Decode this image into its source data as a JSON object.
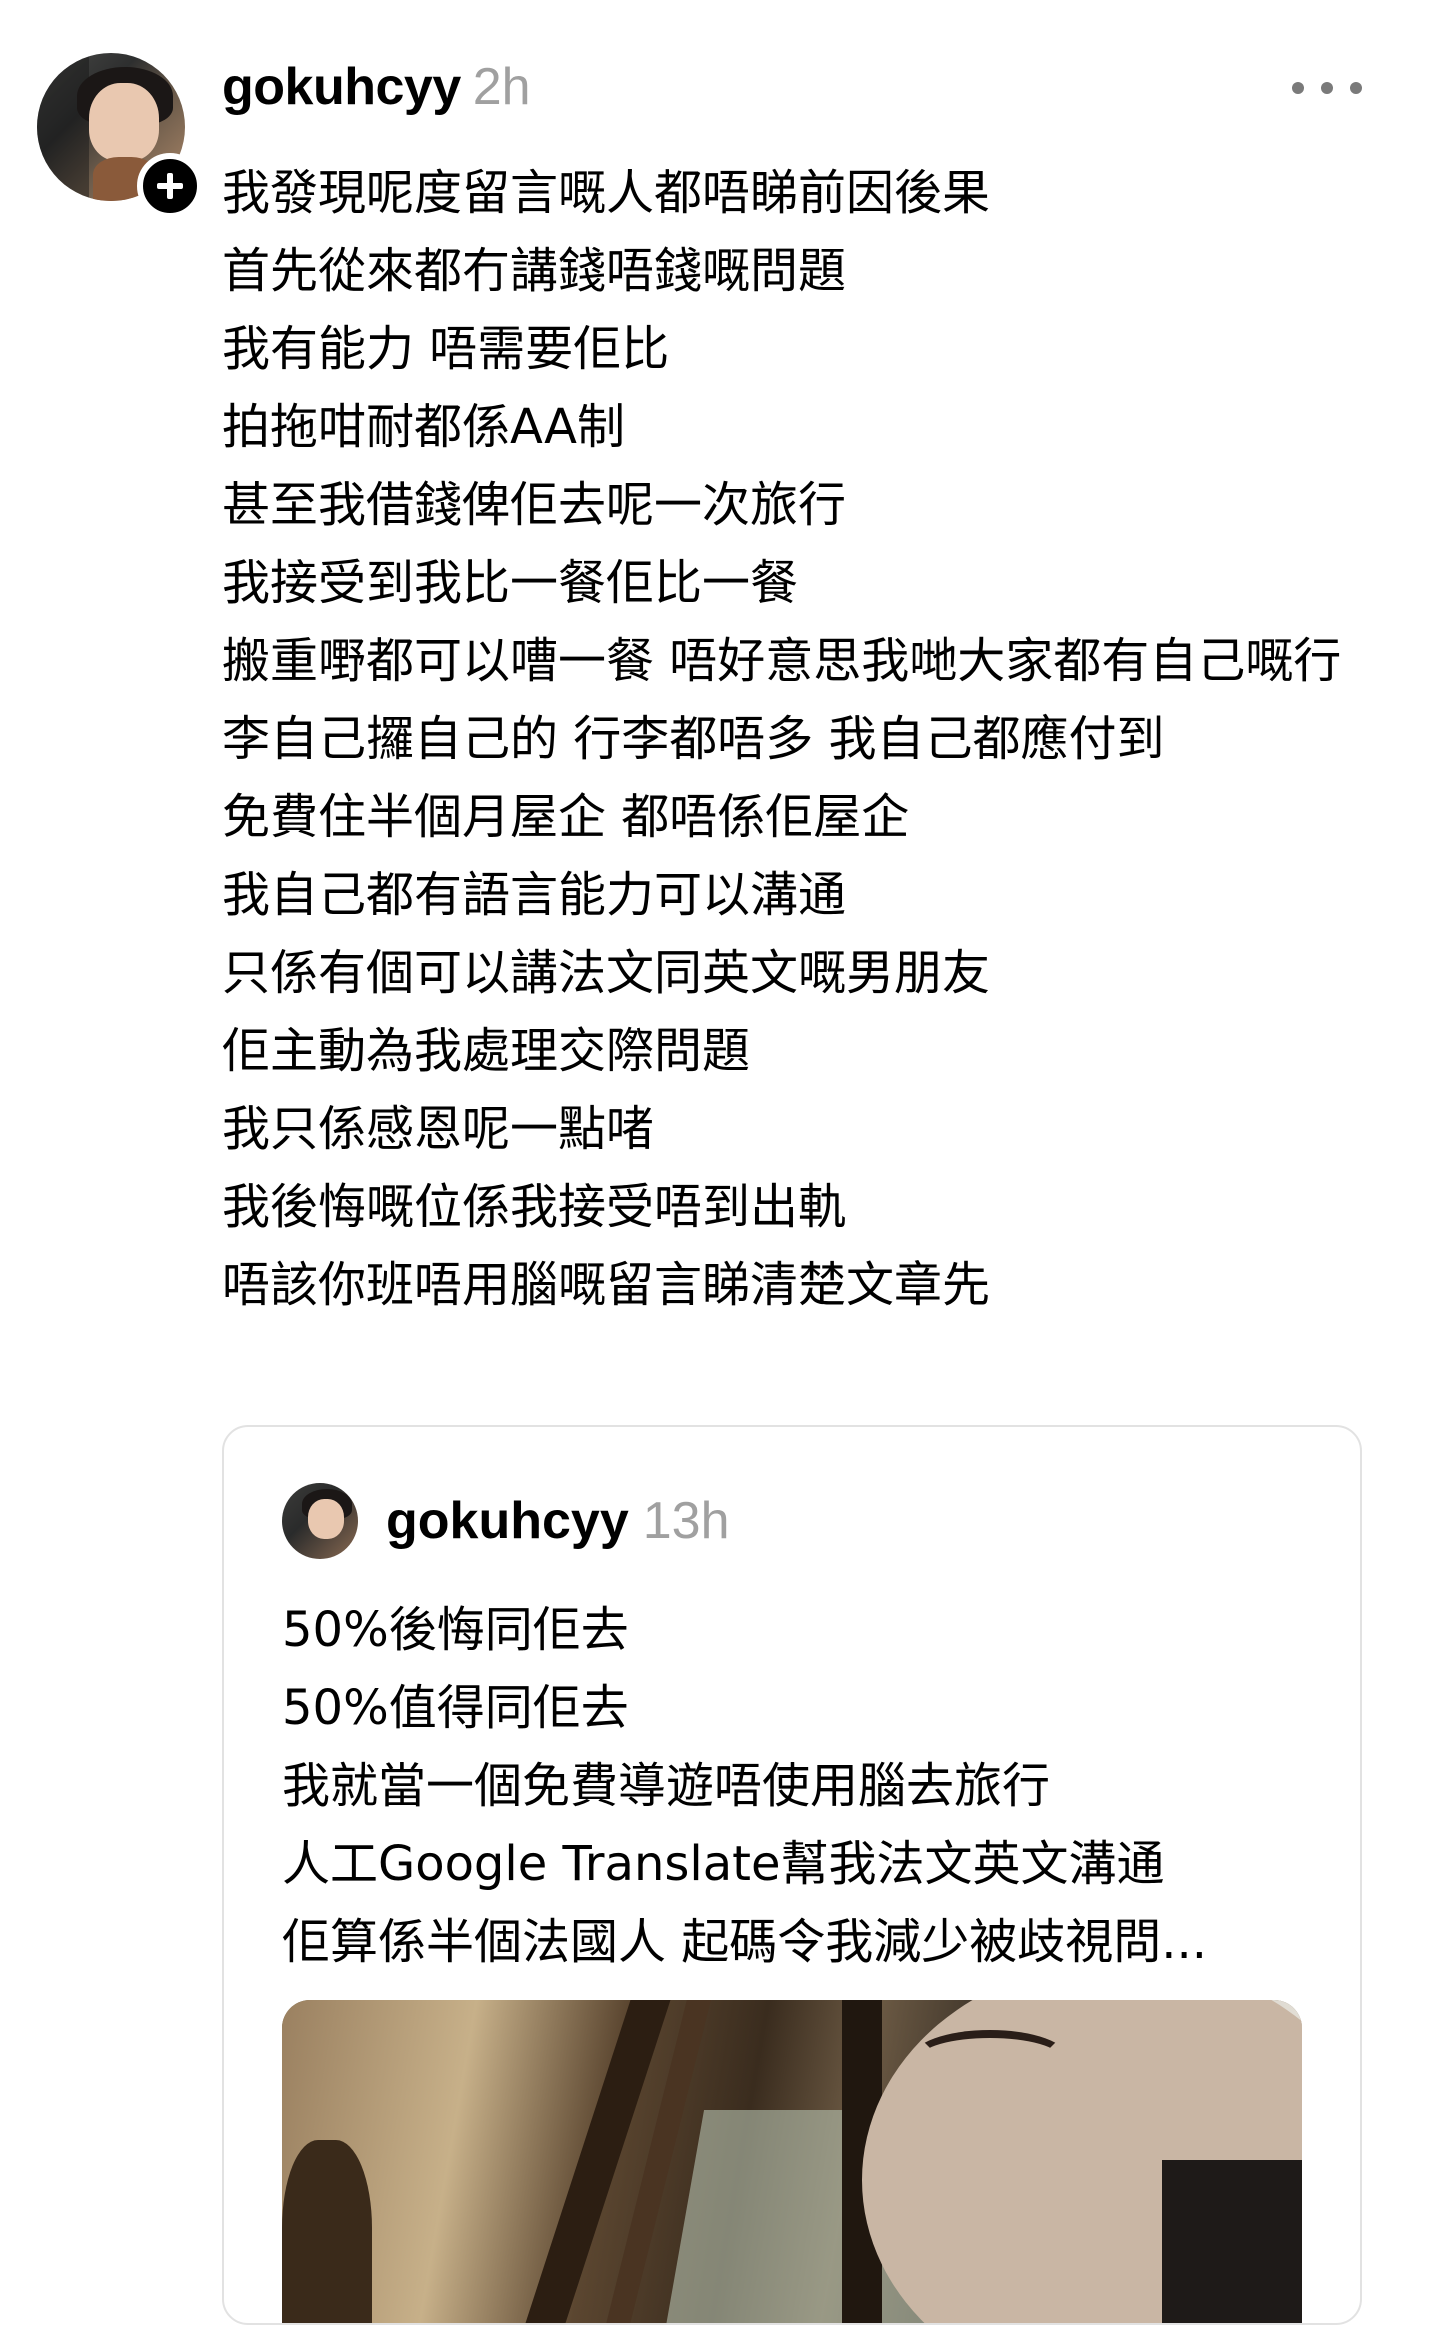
{
  "post": {
    "username": "gokuhcyy",
    "timestamp": "2h",
    "lines": [
      "我發現呢度留言嘅人都唔睇前因後果",
      "首先從來都冇講錢唔錢嘅問題",
      "我有能力 唔需要佢比",
      "拍拖咁耐都係AA制",
      "甚至我借錢俾佢去呢一次旅行",
      "我接受到我比一餐佢比一餐",
      "￼搬重嘢都可以嘈一餐 唔好意思我哋大家都有自己嘅行李自己攞自己的 行李都唔多 我自己都應付到",
      "免費住半個月屋企 都唔係佢屋企",
      "我自己都有語言能力可以溝通",
      "只係有個可以講法文同英文嘅男朋友",
      "佢主動為我處理交際問題",
      "我只係感恩呢一點啫",
      "我後悔嘅位係我接受唔到出軌",
      "唔該你班唔用腦嘅留言睇清楚文章先"
    ]
  },
  "quoted": {
    "username": "gokuhcyy",
    "timestamp": "13h",
    "lines": [
      "50%後悔同佢去",
      "50%值得同佢去",
      "我就當一個免費導遊唔使用腦去旅行￼",
      "人工Google Translate幫我法文英文溝通",
      "佢算係半個法國人 起碼令我減少被歧視問..."
    ]
  }
}
